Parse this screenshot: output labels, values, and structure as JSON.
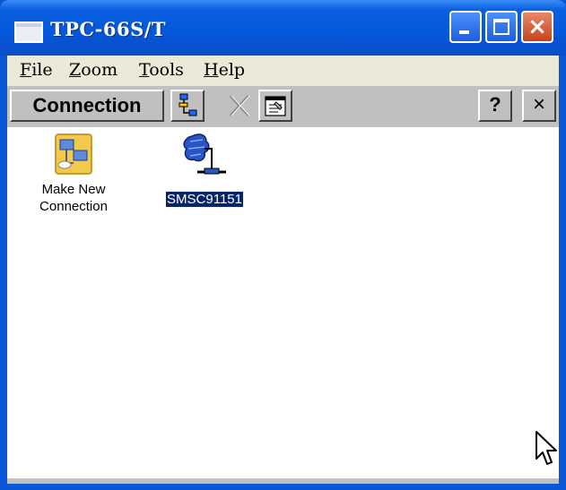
{
  "window": {
    "title": "TPC-66S/T",
    "controls": {
      "minimize": "minimize",
      "maximize": "maximize",
      "close": "×"
    }
  },
  "menu": [
    {
      "label": "File",
      "mnemonic": "F",
      "rest": "ile"
    },
    {
      "label": "Zoom",
      "mnemonic": "Z",
      "rest": "oom"
    },
    {
      "label": "Tools",
      "mnemonic": "T",
      "rest": "ools"
    },
    {
      "label": "Help",
      "mnemonic": "H",
      "rest": "elp"
    }
  ],
  "commandbar": {
    "title": "Connection",
    "tools": [
      "connect-icon",
      "delete-icon",
      "properties-icon"
    ],
    "help_label": "?",
    "close_label": "×"
  },
  "items": [
    {
      "label_line1": "Make New",
      "label_line2": "Connection",
      "icon": "make-new-connection-icon",
      "selected": false
    },
    {
      "label": "SMSC91151",
      "icon": "network-adapter-icon",
      "selected": true
    }
  ],
  "colors": {
    "titlebar": "#0458dc",
    "menubar": "#ece9d8",
    "commandbar": "#c0c0c0",
    "selection": "#0a246a"
  }
}
